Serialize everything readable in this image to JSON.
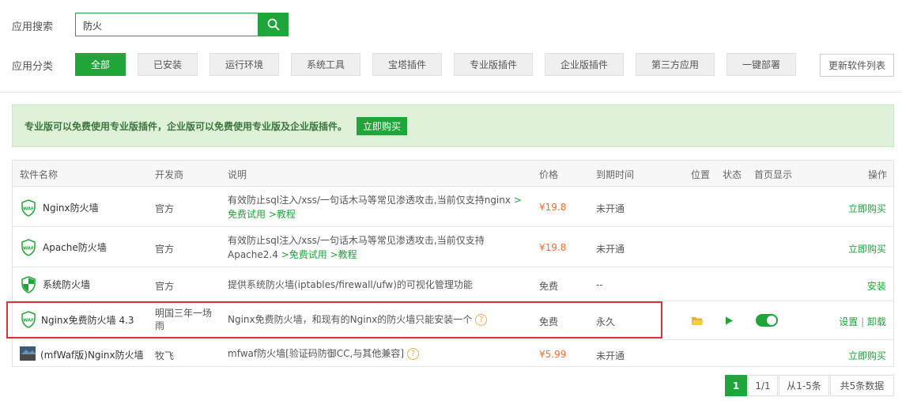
{
  "search": {
    "label": "应用搜索",
    "value": "防火"
  },
  "categories": {
    "label": "应用分类",
    "items": [
      "全部",
      "已安装",
      "运行环境",
      "系统工具",
      "宝塔插件",
      "专业版插件",
      "企业版插件",
      "第三方应用",
      "一键部署"
    ],
    "active_index": 0,
    "refresh_label": "更新软件列表"
  },
  "promo": {
    "text": "专业版可以免费使用专业版插件，企业版可以免费使用专业版及企业版插件。",
    "button": "立即购买"
  },
  "table": {
    "headers": {
      "name": "软件名称",
      "developer": "开发商",
      "description": "说明",
      "price": "价格",
      "expire": "到期时间",
      "location": "位置",
      "status": "状态",
      "homepage": "首页显示",
      "actions": "操作"
    },
    "rows": [
      {
        "icon": "waf-shield-icon",
        "name": "Nginx防火墙",
        "developer": "官方",
        "desc_line1": "有效防止sql注入/xss/一句话木马等常见渗透攻击,当前仅支持nginx",
        "desc_line1_link": ">",
        "desc_line2_links": [
          "免费试用",
          ">教程"
        ],
        "price": "¥19.8",
        "expire": "未开通",
        "action": "立即购买"
      },
      {
        "icon": "waf-shield-icon",
        "name": "Apache防火墙",
        "developer": "官方",
        "desc_line1": "有效防止sql注入/xss/一句话木马等常见渗透攻击,当前仅支持",
        "desc_line2": "Apache2.4",
        "desc_line2_links": [
          ">免费试用",
          ">教程"
        ],
        "price": "¥19.8",
        "expire": "未开通",
        "action": "立即购买"
      },
      {
        "icon": "system-shield-icon",
        "name": "系统防火墙",
        "developer": "官方",
        "desc": "提供系统防火墙(iptables/firewall/ufw)的可视化管理功能",
        "price": "免费",
        "expire": "--",
        "action": "安装"
      },
      {
        "icon": "waf-shield-icon",
        "name": "Nginx免费防火墙 4.3",
        "developer_line1": "明国三年一场",
        "developer_line2": "雨",
        "desc": "Nginx免费防火墙，和现有的Nginx的防火墙只能安装一个",
        "help": "?",
        "price": "免费",
        "expire": "永久",
        "location_icon": "folder-icon",
        "status_icon": "play-icon",
        "homepage_toggle": true,
        "actions": [
          "设置",
          "|",
          "卸载"
        ]
      },
      {
        "icon": "mfwaf-logo-icon",
        "name": "(mfWaf版)Nginx防火墙",
        "developer": "牧飞",
        "desc": "mfwaf防火墙[验证码防御CC,与其他兼容]",
        "help": "?",
        "price": "¥5.99",
        "expire": "未开通",
        "action": "立即购买"
      }
    ]
  },
  "pagination": {
    "current": "1",
    "pages": "1/1",
    "range": "从1-5条",
    "total": "共5条数据"
  },
  "colors": {
    "accent": "#20a53a",
    "price": "#fc6d26",
    "highlight": "#d9343a"
  }
}
